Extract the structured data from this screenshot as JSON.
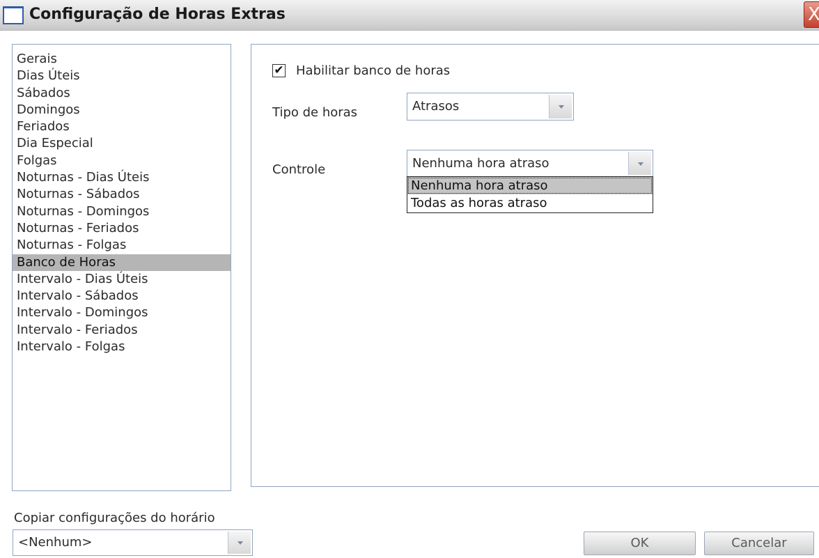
{
  "window": {
    "title": "Configuração de Horas Extras",
    "close_label": "X"
  },
  "sidebar": {
    "items": [
      {
        "label": "Gerais"
      },
      {
        "label": "Dias Úteis"
      },
      {
        "label": "Sábados"
      },
      {
        "label": "Domingos"
      },
      {
        "label": "Feriados"
      },
      {
        "label": "Dia Especial"
      },
      {
        "label": "Folgas"
      },
      {
        "label": "Noturnas - Dias Úteis"
      },
      {
        "label": "Noturnas - Sábados"
      },
      {
        "label": "Noturnas - Domingos"
      },
      {
        "label": "Noturnas - Feriados"
      },
      {
        "label": "Noturnas - Folgas"
      },
      {
        "label": "Banco de Horas",
        "selected": true
      },
      {
        "label": "Intervalo - Dias Úteis"
      },
      {
        "label": "Intervalo - Sábados"
      },
      {
        "label": "Intervalo - Domingos"
      },
      {
        "label": "Intervalo - Feriados"
      },
      {
        "label": "Intervalo - Folgas"
      }
    ]
  },
  "main": {
    "enable_checkbox": {
      "label": "Habilitar banco de horas",
      "checked": true,
      "mark": "✔"
    },
    "tipo_horas": {
      "label": "Tipo de horas",
      "value": "Atrasos"
    },
    "controle": {
      "label": "Controle",
      "value": "Nenhuma hora atraso",
      "options": [
        "Nenhuma hora atraso",
        "Todas as horas atraso"
      ],
      "highlighted_option": "Nenhuma hora atraso"
    }
  },
  "footer": {
    "copy_label": "Copiar configurações do horário",
    "copy_value": "<Nenhum>",
    "ok_label": "OK",
    "cancel_label": "Cancelar"
  },
  "colors": {
    "selected_row": "#b5b5b5",
    "panel_border": "#8fa4c4",
    "close_button": "#c4412e"
  }
}
